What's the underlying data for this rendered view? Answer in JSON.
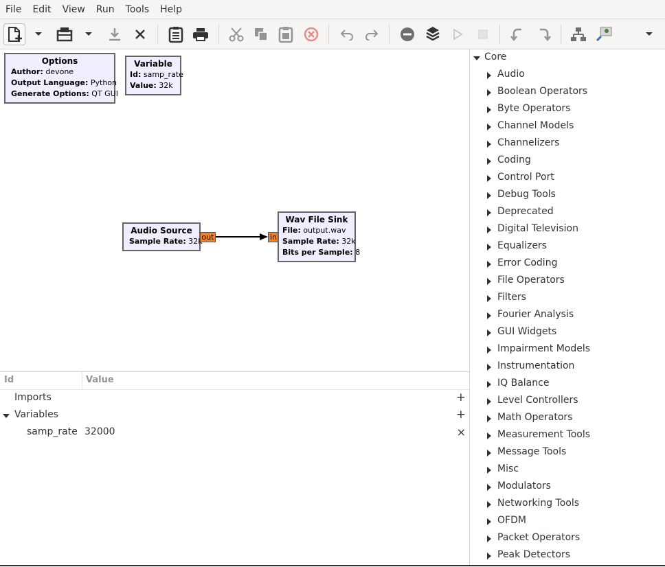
{
  "menubar": {
    "items": [
      "File",
      "Edit",
      "View",
      "Run",
      "Tools",
      "Help"
    ]
  },
  "toolbar": {
    "icons": [
      "new-flowgraph-icon",
      "dropdown-arrow-icon",
      "open-icon",
      "dropdown-arrow-icon",
      "save-icon",
      "close-icon",
      "report-icon",
      "print-icon",
      "cut-icon",
      "copy-icon",
      "paste-icon",
      "delete-icon",
      "undo-icon",
      "redo-icon",
      "disable-icon",
      "bypass-icon",
      "run-icon",
      "stop-icon",
      "rotate-ccw-icon",
      "rotate-cw-icon",
      "hierarchy-icon",
      "find-block-icon",
      "dropdown-arrow-icon"
    ]
  },
  "canvas": {
    "blocks": {
      "options": {
        "title": "Options",
        "params": [
          {
            "key": "Author:",
            "value": "devone"
          },
          {
            "key": "Output Language:",
            "value": "Python"
          },
          {
            "key": "Generate Options:",
            "value": "QT GUI"
          }
        ]
      },
      "variable": {
        "title": "Variable",
        "params": [
          {
            "key": "Id:",
            "value": "samp_rate"
          },
          {
            "key": "Value:",
            "value": "32k"
          }
        ]
      },
      "audio_source": {
        "title": "Audio Source",
        "params": [
          {
            "key": "Sample Rate:",
            "value": "32k"
          }
        ],
        "out_port": "out"
      },
      "wav_file_sink": {
        "title": "Wav File Sink",
        "params": [
          {
            "key": "File:",
            "value": "output.wav"
          },
          {
            "key": "Sample Rate:",
            "value": "32k"
          },
          {
            "key": "Bits per Sample:",
            "value": "8"
          }
        ],
        "in_port": "in"
      }
    }
  },
  "variables_panel": {
    "columns": {
      "id": "Id",
      "value": "Value"
    },
    "rows": [
      {
        "label": "Imports",
        "action": "+"
      },
      {
        "label": "Variables",
        "action": "+"
      },
      {
        "id": "samp_rate",
        "value": "32000",
        "action": "×"
      }
    ]
  },
  "block_tree": {
    "root": "Core",
    "categories": [
      "Audio",
      "Boolean Operators",
      "Byte Operators",
      "Channel Models",
      "Channelizers",
      "Coding",
      "Control Port",
      "Debug Tools",
      "Deprecated",
      "Digital Television",
      "Equalizers",
      "Error Coding",
      "File Operators",
      "Filters",
      "Fourier Analysis",
      "GUI Widgets",
      "Impairment Models",
      "Instrumentation",
      "IQ Balance",
      "Level Controllers",
      "Math Operators",
      "Measurement Tools",
      "Message Tools",
      "Misc",
      "Modulators",
      "Networking Tools",
      "OFDM",
      "Packet Operators",
      "Peak Detectors"
    ]
  },
  "colors": {
    "block_fill": "#f0eeff",
    "block_border": "#666666",
    "port_fill": "#f58220",
    "toolbar_bg": "#f6f5f4"
  }
}
